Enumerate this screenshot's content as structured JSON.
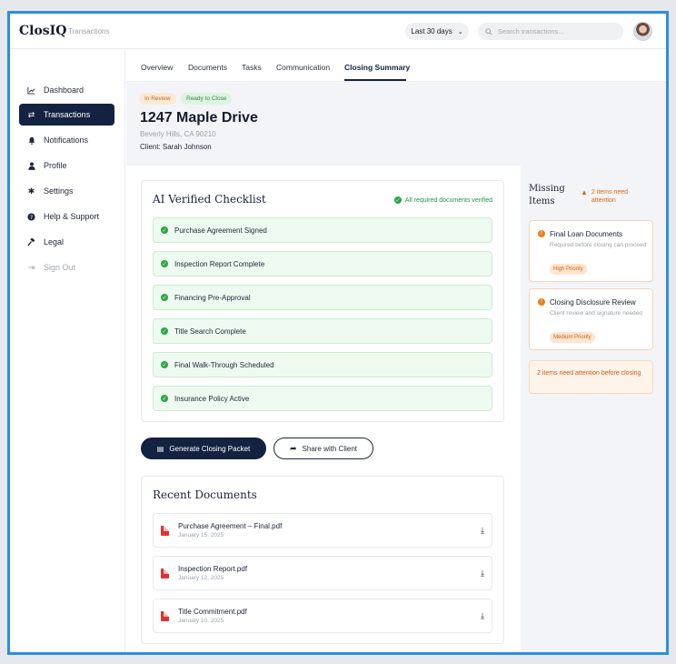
{
  "app": {
    "name": "ClosIQ",
    "section": "Transactions"
  },
  "header_controls": {
    "date_range": "Last 30 days",
    "search_placeholder": "Search transactions..."
  },
  "sidebar": {
    "items": [
      {
        "label": "Dashboard",
        "icon": "chart-line-icon"
      },
      {
        "label": "Transactions",
        "icon": "swap-arrows-icon",
        "active": true
      },
      {
        "label": "Notifications",
        "icon": "bell-icon"
      },
      {
        "label": "Profile",
        "icon": "user-icon"
      },
      {
        "label": "Settings",
        "icon": "gear-icon"
      },
      {
        "label": "Help & Support",
        "icon": "question-circle-icon"
      },
      {
        "label": "Legal",
        "icon": "gavel-icon"
      },
      {
        "label": "Sign Out",
        "icon": "sign-out-icon",
        "muted": true
      }
    ]
  },
  "tabs": [
    "Overview",
    "Documents",
    "Tasks",
    "Communication",
    "Closing Summary"
  ],
  "active_tab": "Closing Summary",
  "property": {
    "badges": [
      "In Review",
      "Ready to Close"
    ],
    "address": "1247 Maple Drive",
    "city": "Beverly Hills, CA 90210",
    "client": "Client: Sarah Johnson"
  },
  "checklist": {
    "title": "AI Verified Checklist",
    "status": "All required documents verified",
    "items": [
      "Purchase Agreement Signed",
      "Inspection Report Complete",
      "Financing Pre-Approval",
      "Title Search Complete",
      "Final Walk-Through Scheduled",
      "Insurance Policy Active"
    ]
  },
  "actions": {
    "generate": "Generate Closing Packet",
    "share": "Share with Client"
  },
  "recent_documents": {
    "title": "Recent Documents",
    "items": [
      {
        "name": "Purchase Agreement – Final.pdf",
        "date": "January 15, 2025"
      },
      {
        "name": "Inspection Report.pdf",
        "date": "January 12, 2025"
      },
      {
        "name": "Title Commitment.pdf",
        "date": "January 10, 2025"
      }
    ]
  },
  "missing_items": {
    "title": "Missing Items",
    "warning": "2 items need attention",
    "items": [
      {
        "title": "Final Loan Documents",
        "desc": "Required before closing can proceed",
        "priority": "High Priority"
      },
      {
        "title": "Closing Disclosure Review",
        "desc": "Client review and signature needed",
        "priority": "Medium Priority"
      }
    ],
    "footer": "2 items need attention before closing"
  },
  "colors": {
    "accent": "#132241",
    "success": "#28a745",
    "warning": "#ee7d22",
    "frame": "#2a8fe0"
  }
}
